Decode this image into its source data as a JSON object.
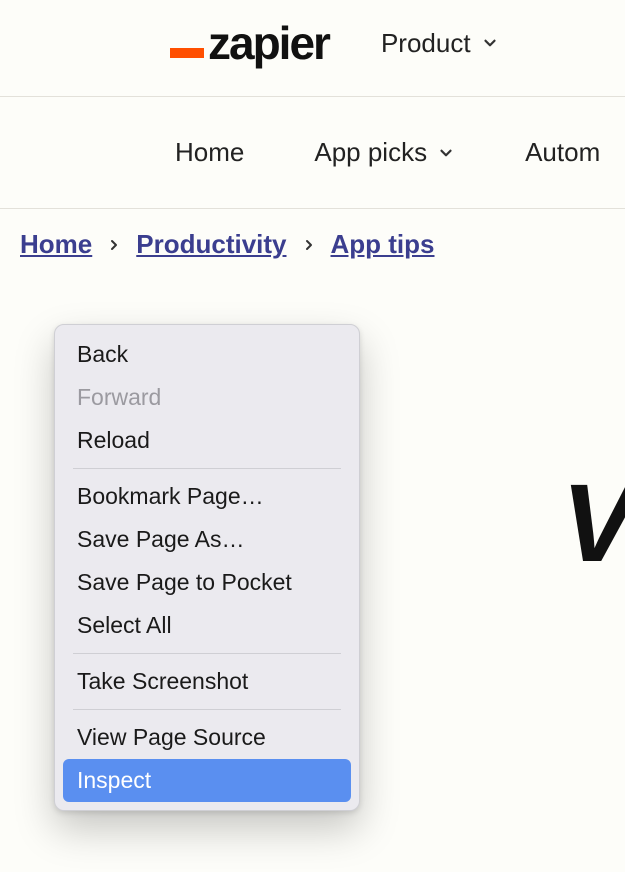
{
  "header": {
    "logo_text": "zapier",
    "product_label": "Product"
  },
  "subnav": {
    "home": "Home",
    "app_picks": "App picks",
    "autom": "Autom"
  },
  "breadcrumbs": {
    "items": [
      "Home",
      "Productivity",
      "App tips"
    ]
  },
  "headline_fragment": "V",
  "context_menu": {
    "groups": [
      [
        {
          "label": "Back",
          "disabled": false
        },
        {
          "label": "Forward",
          "disabled": true
        },
        {
          "label": "Reload",
          "disabled": false
        }
      ],
      [
        {
          "label": "Bookmark Page…",
          "disabled": false
        },
        {
          "label": "Save Page As…",
          "disabled": false
        },
        {
          "label": "Save Page to Pocket",
          "disabled": false
        },
        {
          "label": "Select All",
          "disabled": false
        }
      ],
      [
        {
          "label": "Take Screenshot",
          "disabled": false
        }
      ],
      [
        {
          "label": "View Page Source",
          "disabled": false
        },
        {
          "label": "Inspect",
          "disabled": false,
          "highlighted": true
        }
      ]
    ]
  }
}
